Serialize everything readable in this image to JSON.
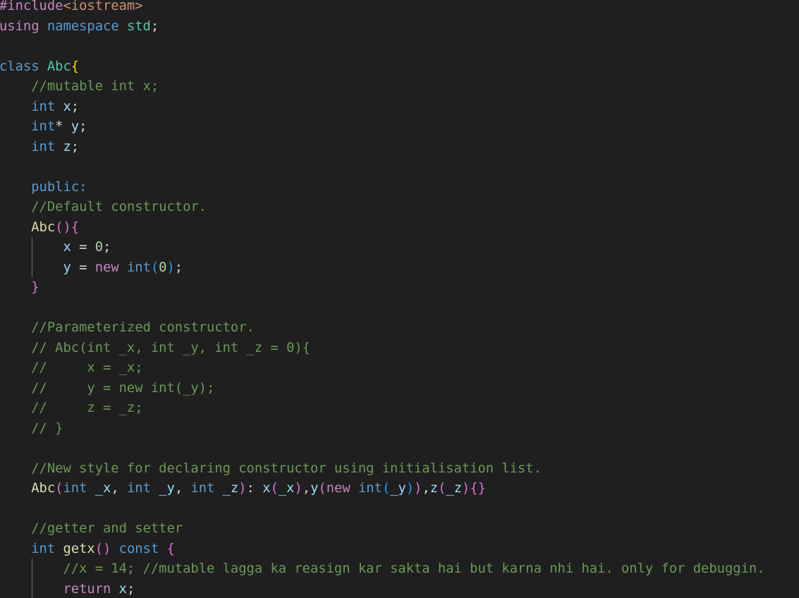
{
  "editor": {
    "language": "cpp",
    "colors": {
      "background": "#1f1f1f",
      "default": "#d4d4d4",
      "keyword": "#569cd6",
      "control": "#c586c0",
      "type": "#4ec9b0",
      "function": "#dcdcaa",
      "variable": "#9cdcfe",
      "number": "#b5cea8",
      "string": "#ce9178",
      "comment": "#6a9955",
      "bracket_gold": "#ffd700",
      "bracket_pink": "#da70d6",
      "bracket_blue": "#179fff"
    },
    "lines": [
      {
        "tokens": [
          {
            "t": "#include",
            "c": "control"
          },
          {
            "t": "<iostream>",
            "c": "string"
          }
        ]
      },
      {
        "tokens": [
          {
            "t": "using",
            "c": "control"
          },
          {
            "t": " ",
            "c": "default"
          },
          {
            "t": "namespace",
            "c": "keyword"
          },
          {
            "t": " ",
            "c": "default"
          },
          {
            "t": "std",
            "c": "type"
          },
          {
            "t": ";",
            "c": "default"
          }
        ]
      },
      {
        "tokens": []
      },
      {
        "tokens": [
          {
            "t": "class",
            "c": "keyword"
          },
          {
            "t": " ",
            "c": "default"
          },
          {
            "t": "Abc",
            "c": "type"
          },
          {
            "t": "{",
            "c": "bracket_gold"
          }
        ]
      },
      {
        "tokens": [
          {
            "t": "    ",
            "c": "default"
          },
          {
            "t": "//mutable int x;",
            "c": "comment"
          }
        ]
      },
      {
        "tokens": [
          {
            "t": "    ",
            "c": "default"
          },
          {
            "t": "int",
            "c": "keyword"
          },
          {
            "t": " ",
            "c": "default"
          },
          {
            "t": "x",
            "c": "variable"
          },
          {
            "t": ";",
            "c": "default"
          }
        ]
      },
      {
        "tokens": [
          {
            "t": "    ",
            "c": "default"
          },
          {
            "t": "int",
            "c": "keyword"
          },
          {
            "t": "*",
            "c": "default"
          },
          {
            "t": " ",
            "c": "default"
          },
          {
            "t": "y",
            "c": "variable"
          },
          {
            "t": ";",
            "c": "default"
          }
        ]
      },
      {
        "tokens": [
          {
            "t": "    ",
            "c": "default"
          },
          {
            "t": "int",
            "c": "keyword"
          },
          {
            "t": " ",
            "c": "default"
          },
          {
            "t": "z",
            "c": "variable"
          },
          {
            "t": ";",
            "c": "default"
          }
        ]
      },
      {
        "tokens": []
      },
      {
        "tokens": [
          {
            "t": "    ",
            "c": "default"
          },
          {
            "t": "public:",
            "c": "keyword"
          }
        ]
      },
      {
        "tokens": [
          {
            "t": "    ",
            "c": "default"
          },
          {
            "t": "//Default constructor.",
            "c": "comment"
          }
        ]
      },
      {
        "tokens": [
          {
            "t": "    ",
            "c": "default"
          },
          {
            "t": "Abc",
            "c": "function"
          },
          {
            "t": "()",
            "c": "bracket_pink"
          },
          {
            "t": "{",
            "c": "bracket_pink"
          }
        ]
      },
      {
        "tokens": [
          {
            "t": "        ",
            "c": "default"
          },
          {
            "t": "x",
            "c": "variable"
          },
          {
            "t": " = ",
            "c": "default"
          },
          {
            "t": "0",
            "c": "number"
          },
          {
            "t": ";",
            "c": "default"
          }
        ]
      },
      {
        "tokens": [
          {
            "t": "        ",
            "c": "default"
          },
          {
            "t": "y",
            "c": "variable"
          },
          {
            "t": " = ",
            "c": "default"
          },
          {
            "t": "new",
            "c": "control"
          },
          {
            "t": " ",
            "c": "default"
          },
          {
            "t": "int",
            "c": "keyword"
          },
          {
            "t": "(",
            "c": "bracket_blue"
          },
          {
            "t": "0",
            "c": "number"
          },
          {
            "t": ")",
            "c": "bracket_blue"
          },
          {
            "t": ";",
            "c": "default"
          }
        ]
      },
      {
        "tokens": [
          {
            "t": "    ",
            "c": "default"
          },
          {
            "t": "}",
            "c": "bracket_pink"
          }
        ]
      },
      {
        "tokens": []
      },
      {
        "tokens": [
          {
            "t": "    ",
            "c": "default"
          },
          {
            "t": "//Parameterized constructor.",
            "c": "comment"
          }
        ]
      },
      {
        "tokens": [
          {
            "t": "    ",
            "c": "default"
          },
          {
            "t": "// Abc(int _x, int _y, int _z = 0){",
            "c": "comment"
          }
        ]
      },
      {
        "tokens": [
          {
            "t": "    ",
            "c": "default"
          },
          {
            "t": "//     x = _x;",
            "c": "comment"
          }
        ]
      },
      {
        "tokens": [
          {
            "t": "    ",
            "c": "default"
          },
          {
            "t": "//     y = new int(_y);",
            "c": "comment"
          }
        ]
      },
      {
        "tokens": [
          {
            "t": "    ",
            "c": "default"
          },
          {
            "t": "//     z = _z;",
            "c": "comment"
          }
        ]
      },
      {
        "tokens": [
          {
            "t": "    ",
            "c": "default"
          },
          {
            "t": "// }",
            "c": "comment"
          }
        ]
      },
      {
        "tokens": []
      },
      {
        "tokens": [
          {
            "t": "    ",
            "c": "default"
          },
          {
            "t": "//New style for declaring constructor using initialisation list.",
            "c": "comment"
          }
        ]
      },
      {
        "tokens": [
          {
            "t": "    ",
            "c": "default"
          },
          {
            "t": "Abc",
            "c": "function"
          },
          {
            "t": "(",
            "c": "bracket_pink"
          },
          {
            "t": "int",
            "c": "keyword"
          },
          {
            "t": " ",
            "c": "default"
          },
          {
            "t": "_x",
            "c": "variable"
          },
          {
            "t": ", ",
            "c": "default"
          },
          {
            "t": "int",
            "c": "keyword"
          },
          {
            "t": " ",
            "c": "default"
          },
          {
            "t": "_y",
            "c": "variable"
          },
          {
            "t": ", ",
            "c": "default"
          },
          {
            "t": "int",
            "c": "keyword"
          },
          {
            "t": " ",
            "c": "default"
          },
          {
            "t": "_z",
            "c": "variable"
          },
          {
            "t": ")",
            "c": "bracket_pink"
          },
          {
            "t": ": ",
            "c": "default"
          },
          {
            "t": "x",
            "c": "variable"
          },
          {
            "t": "(",
            "c": "bracket_pink"
          },
          {
            "t": "_x",
            "c": "variable"
          },
          {
            "t": ")",
            "c": "bracket_pink"
          },
          {
            "t": ",",
            "c": "default"
          },
          {
            "t": "y",
            "c": "variable"
          },
          {
            "t": "(",
            "c": "bracket_pink"
          },
          {
            "t": "new",
            "c": "control"
          },
          {
            "t": " ",
            "c": "default"
          },
          {
            "t": "int",
            "c": "keyword"
          },
          {
            "t": "(",
            "c": "bracket_blue"
          },
          {
            "t": "_y",
            "c": "variable"
          },
          {
            "t": ")",
            "c": "bracket_blue"
          },
          {
            "t": ")",
            "c": "bracket_pink"
          },
          {
            "t": ",",
            "c": "default"
          },
          {
            "t": "z",
            "c": "variable"
          },
          {
            "t": "(",
            "c": "bracket_pink"
          },
          {
            "t": "_z",
            "c": "variable"
          },
          {
            "t": ")",
            "c": "bracket_pink"
          },
          {
            "t": "{}",
            "c": "bracket_pink"
          }
        ]
      },
      {
        "tokens": []
      },
      {
        "tokens": [
          {
            "t": "    ",
            "c": "default"
          },
          {
            "t": "//getter and setter",
            "c": "comment"
          }
        ]
      },
      {
        "tokens": [
          {
            "t": "    ",
            "c": "default"
          },
          {
            "t": "int",
            "c": "keyword"
          },
          {
            "t": " ",
            "c": "default"
          },
          {
            "t": "getx",
            "c": "function"
          },
          {
            "t": "()",
            "c": "bracket_pink"
          },
          {
            "t": " ",
            "c": "default"
          },
          {
            "t": "const",
            "c": "keyword"
          },
          {
            "t": " ",
            "c": "default"
          },
          {
            "t": "{",
            "c": "bracket_pink"
          }
        ]
      },
      {
        "tokens": [
          {
            "t": "        ",
            "c": "default"
          },
          {
            "t": "//x = 14; //mutable lagga ka reasign kar sakta hai but karna nhi hai. only for debuggin.",
            "c": "comment"
          }
        ]
      },
      {
        "tokens": [
          {
            "t": "        ",
            "c": "default"
          },
          {
            "t": "return",
            "c": "control"
          },
          {
            "t": " ",
            "c": "default"
          },
          {
            "t": "x",
            "c": "variable"
          },
          {
            "t": ";",
            "c": "default"
          }
        ]
      }
    ]
  }
}
